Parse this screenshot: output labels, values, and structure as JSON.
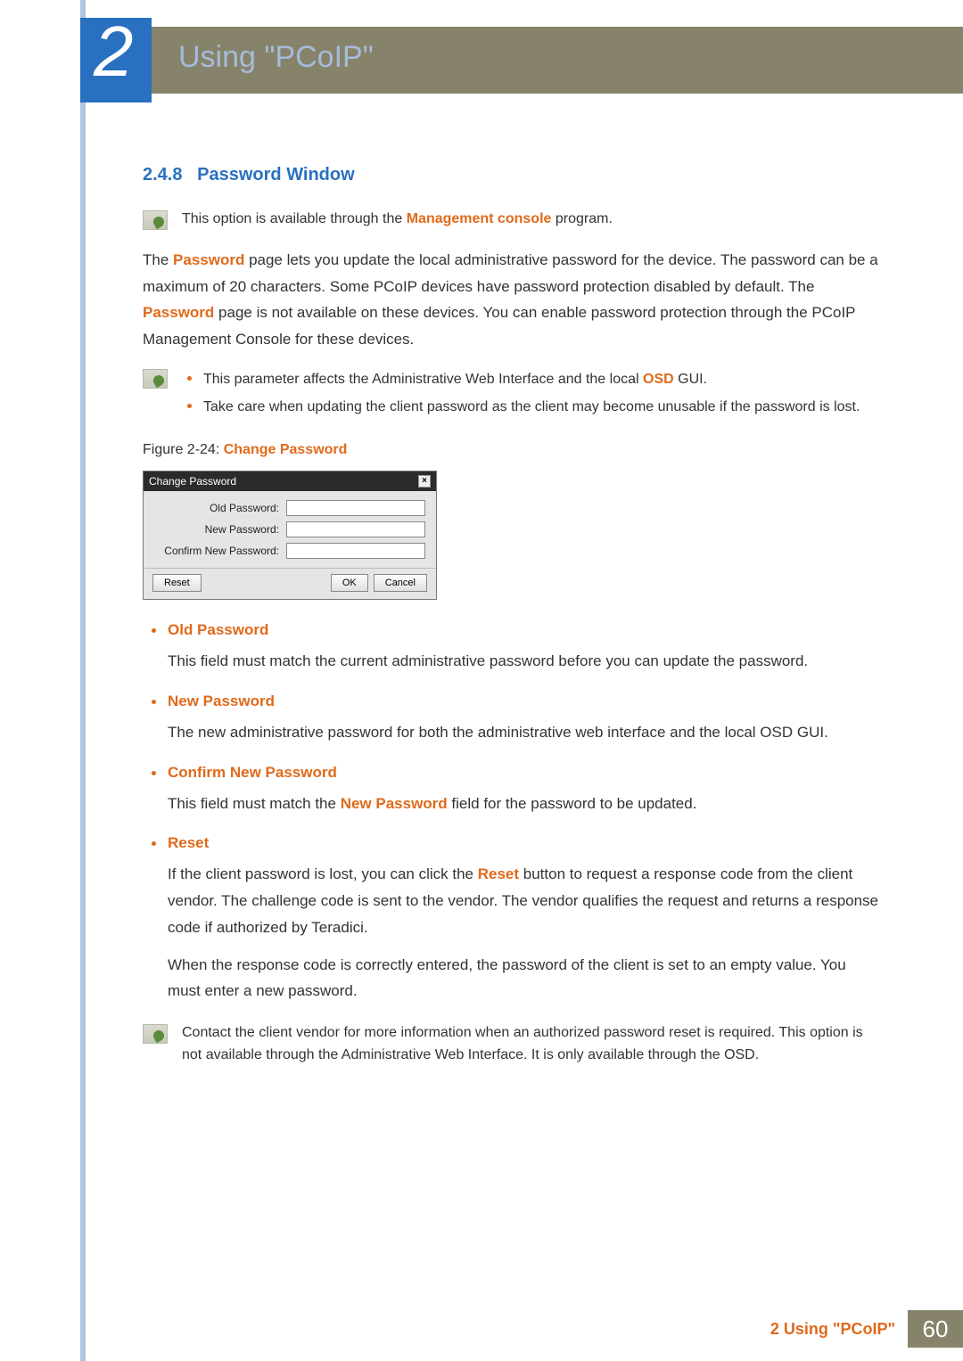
{
  "chapter": {
    "number": "2",
    "title": "Using \"PCoIP\""
  },
  "section": {
    "number": "2.4.8",
    "title": "Password Window"
  },
  "note1": {
    "prefix": "This option is available through the ",
    "highlight": "Management console",
    "suffix": " program."
  },
  "para1": {
    "t1": "The ",
    "h1": "Password",
    "t2": " page lets you update the local administrative password for the device. The password can be a maximum of 20 characters. Some PCoIP devices have password protection disabled by default. The ",
    "h2": "Password",
    "t3": " page is not available on these devices. You can enable password protection through the PCoIP Management Console for these devices."
  },
  "note2": {
    "item1_prefix": "This parameter affects the Administrative Web Interface and the local ",
    "item1_highlight": "OSD",
    "item1_suffix": " GUI.",
    "item2": "Take care when updating the client password as the client may become unusable if the password is lost."
  },
  "figure": {
    "label": "Figure 2-24: ",
    "title": "Change Password"
  },
  "dialog": {
    "title": "Change Password",
    "close": "×",
    "old_label": "Old Password:",
    "new_label": "New Password:",
    "confirm_label": "Confirm New Password:",
    "reset": "Reset",
    "ok": "OK",
    "cancel": "Cancel"
  },
  "defs": {
    "old": {
      "title": "Old Password",
      "body": "This field must match the current administrative password before you can update the password."
    },
    "new": {
      "title": "New Password",
      "body": "The new administrative password for both the administrative web interface and the local OSD GUI."
    },
    "confirm": {
      "title": "Confirm New Password",
      "body_prefix": "This field must match the ",
      "body_highlight": "New Password",
      "body_suffix": " field for the password to be updated."
    },
    "reset": {
      "title": "Reset",
      "body1_prefix": "If the client password is lost, you can click the ",
      "body1_highlight": "Reset",
      "body1_suffix": " button to request a response code from the client vendor. The challenge code is sent to the vendor. The vendor qualifies the request and returns a response code if authorized by Teradici.",
      "body2": "When the response code is correctly entered, the password of the client is set to an empty value. You must enter a new password."
    }
  },
  "note3": "Contact the client vendor for more information when an authorized password reset is required. This option is not available through the Administrative Web Interface. It is only available through the OSD.",
  "footer": {
    "text": "2 Using \"PCoIP\"",
    "page": "60"
  }
}
